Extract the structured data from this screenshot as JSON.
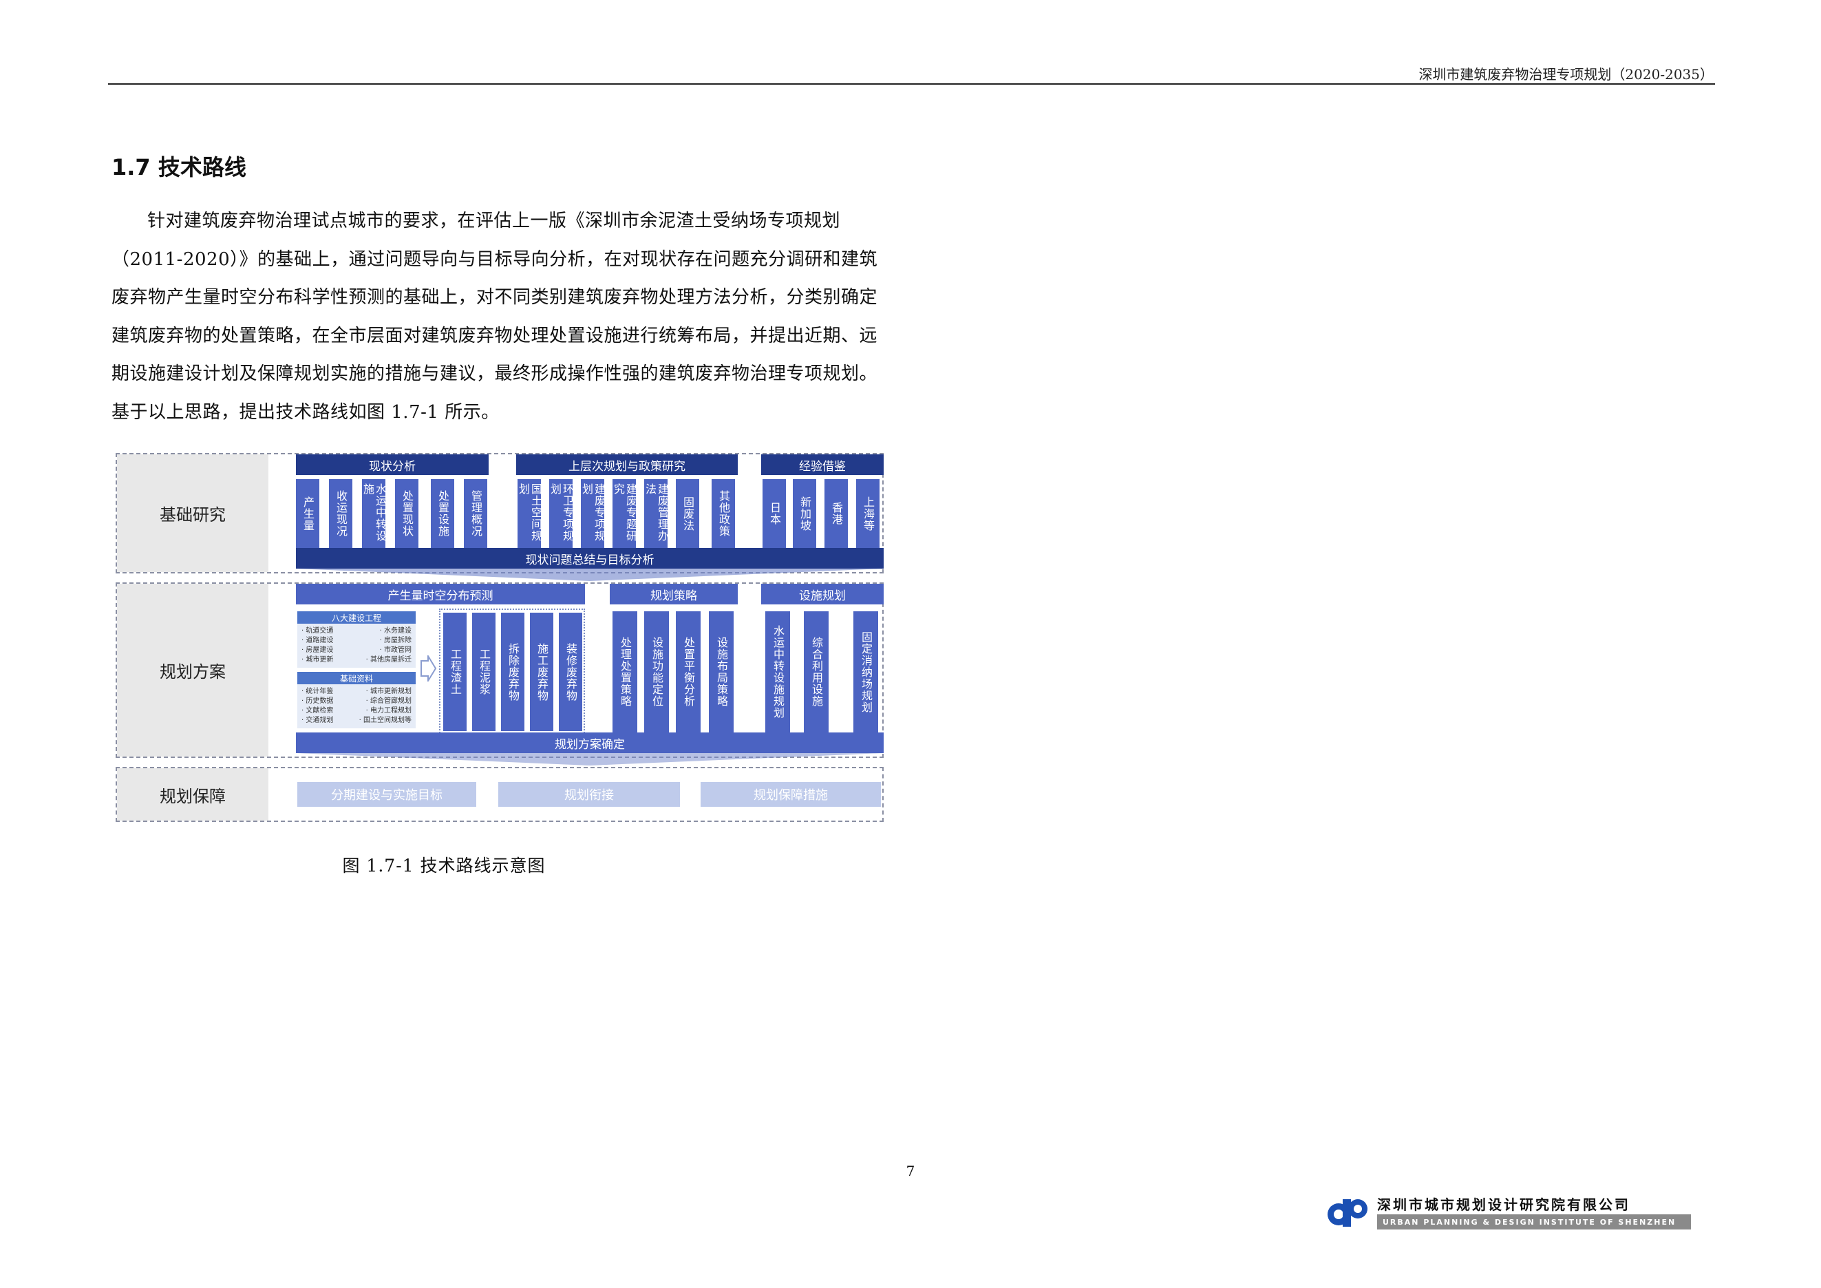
{
  "header": {
    "title": "深圳市建筑废弃物治理专项规划（2020-2035）"
  },
  "section": {
    "title": "1.7 技术路线"
  },
  "body": {
    "paragraph": "针对建筑废弃物治理试点城市的要求，在评估上一版《深圳市余泥渣土受纳场专项规划（2011-2020）》的基础上，通过问题导向与目标导向分析，在对现状存在问题充分调研和建筑废弃物产生量时空分布科学性预测的基础上，对不同类别建筑废弃物处理方法分析，分类别确定建筑废弃物的处置策略，在全市层面对建筑废弃物处理处置设施进行统筹布局，并提出近期、远期设施建设计划及保障规划实施的措施与建议，最终形成操作性强的建筑废弃物治理专项规划。基于以上思路，提出技术路线如图 1.7-1 所示。"
  },
  "diagram": {
    "band1": {
      "label": "基础研究",
      "group1": {
        "title": "现状分析",
        "items": [
          "产生量",
          "收运现况",
          "水运中转设施",
          "处置现状",
          "处置设施",
          "管理概况"
        ]
      },
      "group2": {
        "title": "上层次规划与政策研究",
        "items": [
          "国土空间规划",
          "环卫专项规划",
          "建废专项规划",
          "建废专题研究",
          "建废管理办法",
          "固废法",
          "其他政策"
        ]
      },
      "group3": {
        "title": "经验借鉴",
        "items": [
          "日本",
          "新加坡",
          "香港",
          "上海等"
        ]
      },
      "summary": "现状问题总结与目标分析"
    },
    "band2": {
      "label": "规划方案",
      "group1": {
        "title": "产生量时空分布预测",
        "mini1": {
          "title": "八大建设工程",
          "rows": [
            [
              "· 轨道交通",
              "· 水务建设"
            ],
            [
              "· 道路建设",
              "· 房屋拆除"
            ],
            [
              "· 房屋建设",
              "· 市政管网"
            ],
            [
              "· 城市更新",
              "· 其他房屋拆迁"
            ]
          ]
        },
        "mini2": {
          "title": "基础资料",
          "rows": [
            [
              "· 统计年鉴",
              "· 城市更新规划"
            ],
            [
              "· 历史数据",
              "· 综合管廊规划"
            ],
            [
              "· 文献检索",
              "· 电力工程规划"
            ],
            [
              "· 交通规划",
              "· 国土空间规划等"
            ]
          ]
        },
        "items": [
          "工程渣土",
          "工程泥浆",
          "拆除废弃物",
          "施工废弃物",
          "装修废弃物"
        ]
      },
      "group2": {
        "title": "规划策略",
        "items": [
          "处理处置策略",
          "设施功能定位",
          "处置平衡分析",
          "设施布局策略"
        ]
      },
      "group3": {
        "title": "设施规划",
        "items": [
          "水运中转设施规划",
          "综合利用设施",
          "固定消纳场规划"
        ]
      },
      "summary": "规划方案确定"
    },
    "band3": {
      "label": "规划保障",
      "items": [
        "分期建设与实施目标",
        "规划衔接",
        "规划保障措施"
      ]
    }
  },
  "caption": "图 1.7-1  技术路线示意图",
  "page_number": "7",
  "logo": {
    "name": "深圳市城市规划设计研究院有限公司",
    "english": "URBAN PLANNING & DESIGN INSTITUTE OF SHENZHEN"
  }
}
